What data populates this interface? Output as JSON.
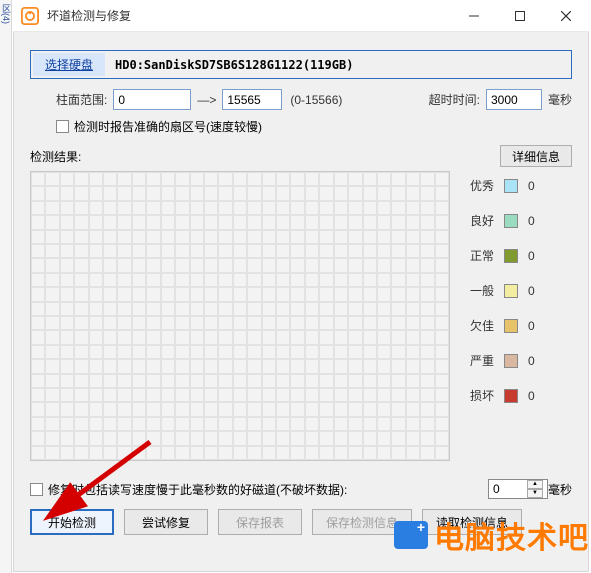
{
  "titlebar": {
    "title": "坏道检测与修复"
  },
  "disk": {
    "select_btn": "选择硬盘",
    "info": "HD0:SanDiskSD7SB6S128G1122(119GB)"
  },
  "range": {
    "label": "柱面范围:",
    "from": "0",
    "arrow": "—>",
    "to": "15565",
    "hint": "(0-15566)",
    "timeout_label": "超时时间:",
    "timeout_value": "3000",
    "timeout_unit": "毫秒"
  },
  "accurate_check": {
    "label": "检测时报告准确的扇区号(速度较慢)"
  },
  "result": {
    "label": "检测结果:",
    "detail_btn": "详细信息"
  },
  "legend": {
    "items": [
      {
        "name": "优秀",
        "color": "#a9e3f5",
        "count": "0"
      },
      {
        "name": "良好",
        "color": "#9bdcc0",
        "count": "0"
      },
      {
        "name": "正常",
        "color": "#7f9a2e",
        "count": "0"
      },
      {
        "name": "一般",
        "color": "#f2eda0",
        "count": "0"
      },
      {
        "name": "欠佳",
        "color": "#e6c36a",
        "count": "0"
      },
      {
        "name": "严重",
        "color": "#d9b7a0",
        "count": "0"
      },
      {
        "name": "损坏",
        "color": "#c73a2e",
        "count": "0"
      }
    ]
  },
  "repair": {
    "label": "修复时包括读写速度慢于此毫秒数的好磁道(不破坏数据):",
    "value": "0",
    "unit": "毫秒"
  },
  "buttons": {
    "start": "开始检测",
    "tryrepair": "尝试修复",
    "savereport": "保存报表",
    "saveinfo": "保存检测信息",
    "loadinfo": "读取检测信息"
  },
  "watermark": "电脑技术吧"
}
